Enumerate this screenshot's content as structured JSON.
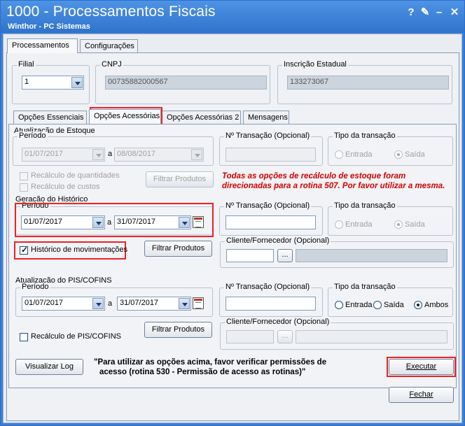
{
  "window": {
    "title": "1000 - Processamentos Fiscais",
    "subtitle": "Winthor - PC Sistemas",
    "help_icon": "?",
    "edit_icon": "✎",
    "minimize_icon": "–",
    "close_icon": "✕"
  },
  "top_tabs": [
    {
      "label": "Processamentos"
    },
    {
      "label": "Configurações"
    }
  ],
  "filial": {
    "label": "Filial",
    "value": "1"
  },
  "cnpj": {
    "label": "CNPJ",
    "value": "00735882000567"
  },
  "ie": {
    "label": "Inscrição Estadual",
    "value": "133273067"
  },
  "sub_tabs": [
    {
      "label": "Opções Essenciais"
    },
    {
      "label": "Opções Acessórias"
    },
    {
      "label": "Opções Acessórias 2"
    },
    {
      "label": "Mensagens"
    }
  ],
  "estoque": {
    "title": "Atualização de Estoque",
    "periodo_label": "Período",
    "date_from": "01/07/2017",
    "date_sep": "a",
    "date_to": "08/08/2017",
    "ntrans_label": "Nº Transação (Opcional)",
    "tipo_label": "Tipo da transação",
    "entrada": "Entrada",
    "saida": "Saída",
    "recalc_qtd": "Recálculo de quantidades",
    "recalc_custo": "Recálculo de custos",
    "filtrar": "Filtrar Produtos",
    "warning_line1": "Todas as opções de recálculo de estoque foram",
    "warning_line2": "direcionadas para a rotina 507. Por favor utilizar a mesma."
  },
  "historico": {
    "title": "Geração do Histórico",
    "periodo_label": "Período",
    "date_from": "01/07/2017",
    "date_sep": "a",
    "date_to": "31/07/2017",
    "ntrans_label": "Nº Transação (Opcional)",
    "tipo_label": "Tipo da transação",
    "entrada": "Entrada",
    "saida": "Saída",
    "hist_mov": "Histórico de movimentações",
    "filtrar": "Filtrar Produtos",
    "cliente_label": "Cliente/Fornecedor (Opcional)",
    "ellipsis": "..."
  },
  "pis": {
    "title": "Atualização do PIS/COFINS",
    "periodo_label": "Período",
    "date_from": "01/07/2017",
    "date_sep": "a",
    "date_to": "31/07/2017",
    "ntrans_label": "Nº Transação (Opcional)",
    "tipo_label": "Tipo da transação",
    "entrada": "Entrada",
    "saida": "Saída",
    "ambos": "Ambos",
    "recalc": "Recálculo de PIS/COFINS",
    "filtrar": "Filtrar Produtos",
    "cliente_label": "Cliente/Fornecedor (Opcional)",
    "ellipsis": "..."
  },
  "footer": {
    "log_button": "Visualizar Log",
    "note_line1": "\"Para utilizar as opções acima, favor verificar permissões de",
    "note_line2": "acesso (rotina 530 - Permissão de acesso as rotinas)\"",
    "executar": "Executar",
    "fechar": "Fechar"
  }
}
